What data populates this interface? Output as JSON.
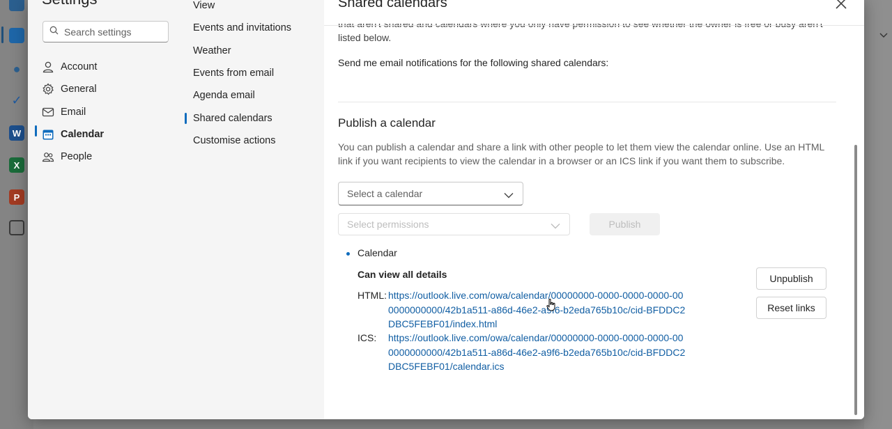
{
  "settings": {
    "title": "Settings",
    "search_placeholder": "Search settings"
  },
  "categories": [
    {
      "label": "Account",
      "icon": "person-icon"
    },
    {
      "label": "General",
      "icon": "gear-icon"
    },
    {
      "label": "Email",
      "icon": "mail-icon"
    },
    {
      "label": "Calendar",
      "icon": "calendar-icon",
      "active": true
    },
    {
      "label": "People",
      "icon": "people-icon"
    }
  ],
  "subcategories": [
    "View",
    "Events and invitations",
    "Weather",
    "Events from email",
    "Agenda email",
    "Shared calendars",
    "Customise actions"
  ],
  "content": {
    "title": "Shared calendars",
    "cut_text": "that aren't shared and calendars where you only have permission to see whether the owner is free or busy aren't listed below.",
    "notify_text": "Send me email notifications for the following shared calendars:",
    "publish": {
      "title": "Publish a calendar",
      "description": "You can publish a calendar and share a link with other people to let them view the calendar online. Use an HTML link if you want recipients to view the calendar in a browser or an ICS link if you want them to subscribe.",
      "select_calendar_placeholder": "Select a calendar",
      "select_permissions_placeholder": "Select permissions",
      "publish_button": "Publish",
      "published": {
        "calendar_name": "Calendar",
        "permission": "Can view all details",
        "html_label": "HTML:",
        "html_link": "https://outlook.live.com/owa/calendar/00000000-0000-0000-0000-000000000000/42b1a511-a86d-46e2-a9f6-b2eda765b10c/cid-BFDDC2DBC5FEBF01/index.html",
        "ics_label": "ICS:",
        "ics_link": "https://outlook.live.com/owa/calendar/00000000-0000-0000-0000-000000000000/42b1a511-a86d-46e2-a9f6-b2eda765b10c/cid-BFDDC2DBC5FEBF01/calendar.ics",
        "unpublish_button": "Unpublish",
        "reset_links_button": "Reset links"
      }
    }
  },
  "colors": {
    "accent": "#0f6cbd",
    "link": "#115ea3"
  }
}
